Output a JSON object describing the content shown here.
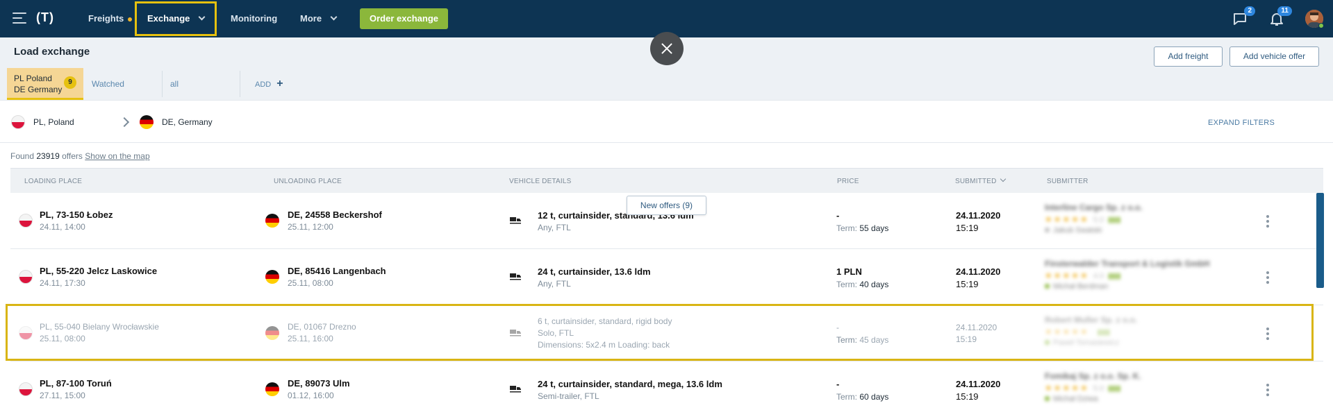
{
  "nav": {
    "items": [
      {
        "label": "Freights"
      },
      {
        "label": "Exchange"
      },
      {
        "label": "Monitoring"
      },
      {
        "label": "More"
      }
    ],
    "logo": "(T)",
    "order_button": "Order exchange",
    "messages_badge": "2",
    "notifications_badge": "11"
  },
  "header": {
    "title": "Load exchange",
    "add_freight": "Add freight",
    "add_vehicle_offer": "Add vehicle offer",
    "tabs": {
      "active_line1": "PL Poland",
      "active_line2": "DE Germany",
      "active_count": "9",
      "watched": "Watched",
      "all": "all",
      "add": "ADD"
    }
  },
  "filters": {
    "from": "PL, Poland",
    "to": "DE, Germany",
    "expand": "EXPAND FILTERS"
  },
  "found": {
    "prefix": "Found",
    "count": "23919",
    "suffix": "offers",
    "map_link": "Show on the map"
  },
  "table": {
    "columns": {
      "loading": "LOADING PLACE",
      "unloading": "UNLOADING PLACE",
      "vehicle": "VEHICLE DETAILS",
      "price": "PRICE",
      "submitted": "SUBMITTED",
      "submitter": "SUBMITTER"
    },
    "new_offers": "New offers (9)",
    "rows": [
      {
        "load_place": "PL, 73-150 Łobez",
        "load_date": "24.11, 14:00",
        "unload_place": "DE, 24558 Beckershof",
        "unload_date": "25.11, 12:00",
        "vehicle_main": "12 t, curtainsider, standard, 13.6 ldm",
        "vehicle_sub": "Any, FTL",
        "vehicle_extra": "",
        "price": "-",
        "term_label": "Term:",
        "term_value": "55 days",
        "submitted_date": "24.11.2020",
        "submitted_time": "15:19",
        "submitter_company": "Interline Cargo Sp. z o.o.",
        "submitter_rating": "5.0",
        "submitter_person": "Jakub Swatski"
      },
      {
        "load_place": "PL, 55-220 Jelcz Laskowice",
        "load_date": "24.11, 17:30",
        "unload_place": "DE, 85416 Langenbach",
        "unload_date": "25.11, 08:00",
        "vehicle_main": "24 t, curtainsider, 13.6 ldm",
        "vehicle_sub": "Any, FTL",
        "vehicle_extra": "",
        "price": "1 PLN",
        "term_label": "Term:",
        "term_value": "40 days",
        "submitted_date": "24.11.2020",
        "submitted_time": "15:19",
        "submitter_company": "Finsterwalder Transport & Logistik GmbH",
        "submitter_rating": "4.0",
        "submitter_person": "Michał Berdman"
      },
      {
        "load_place": "PL, 55-040 Bielany Wrocławskie",
        "load_date": "25.11, 08:00",
        "unload_place": "DE, 01067 Drezno",
        "unload_date": "25.11, 16:00",
        "vehicle_main": "6 t, curtainsider, standard, rigid body",
        "vehicle_sub": "Solo, FTL",
        "vehicle_extra": "Dimensions: 5x2.4 m Loading: back",
        "price": "-",
        "term_label": "Term:",
        "term_value": "45 days",
        "submitted_date": "24.11.2020",
        "submitted_time": "15:19",
        "submitter_company": "Robert Muller Sp. z o.o.",
        "submitter_rating": "",
        "submitter_person": "Paweł Tomasiewicz"
      },
      {
        "load_place": "PL, 87-100 Toruń",
        "load_date": "27.11, 15:00",
        "unload_place": "DE, 89073 Ulm",
        "unload_date": "01.12, 16:00",
        "vehicle_main": "24 t, curtainsider, standard, mega, 13.6 ldm",
        "vehicle_sub": "Semi-trailer, FTL",
        "vehicle_extra": "",
        "price": "-",
        "term_label": "Term:",
        "term_value": "60 days",
        "submitted_date": "24.11.2020",
        "submitted_time": "15:19",
        "submitter_company": "Fomikaj Sp. z o.o. Sp. K.",
        "submitter_rating": "5.0",
        "submitter_person": "Michał Dziwa"
      }
    ]
  },
  "colors": {
    "nav_bg": "#0d3453",
    "accent_yellow": "#e6c10f",
    "order_green": "#8bb73b",
    "link_blue": "#2f5b80"
  }
}
